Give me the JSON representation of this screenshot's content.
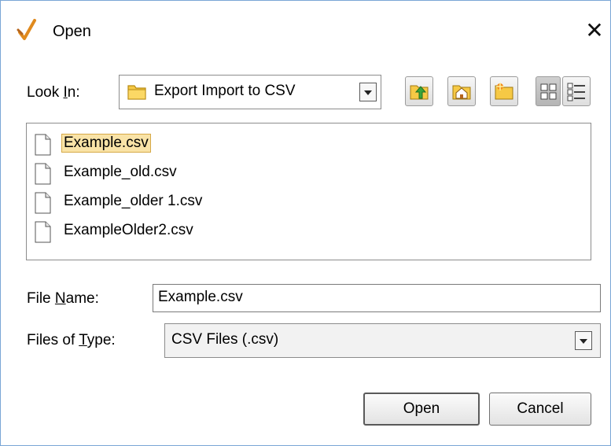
{
  "window": {
    "title": "Open",
    "close_glyph": "✕"
  },
  "look_in": {
    "label_prefix": "Look ",
    "label_accel": "I",
    "label_suffix": "n:",
    "value": "Export Import to CSV"
  },
  "toolbar": {
    "buttons": [
      {
        "name": "up-one-level-icon"
      },
      {
        "name": "home-icon"
      },
      {
        "name": "new-folder-icon"
      },
      {
        "name": "list-view-icon"
      },
      {
        "name": "details-view-icon"
      }
    ]
  },
  "files": [
    {
      "name": "Example.csv",
      "selected": true
    },
    {
      "name": "Example_old.csv",
      "selected": false
    },
    {
      "name": "Example_older 1.csv",
      "selected": false
    },
    {
      "name": "ExampleOlder2.csv",
      "selected": false
    }
  ],
  "file_name": {
    "label_prefix": "File ",
    "label_accel": "N",
    "label_suffix": "ame:",
    "value": "Example.csv"
  },
  "file_type": {
    "label_prefix": "Files of ",
    "label_accel": "T",
    "label_suffix": "ype:",
    "value": "CSV Files (.csv)"
  },
  "buttons": {
    "open": "Open",
    "cancel": "Cancel"
  },
  "colors": {
    "selection": "#f9e3a7",
    "selection_border": "#d6a948",
    "window_border": "#7aa6d6"
  }
}
